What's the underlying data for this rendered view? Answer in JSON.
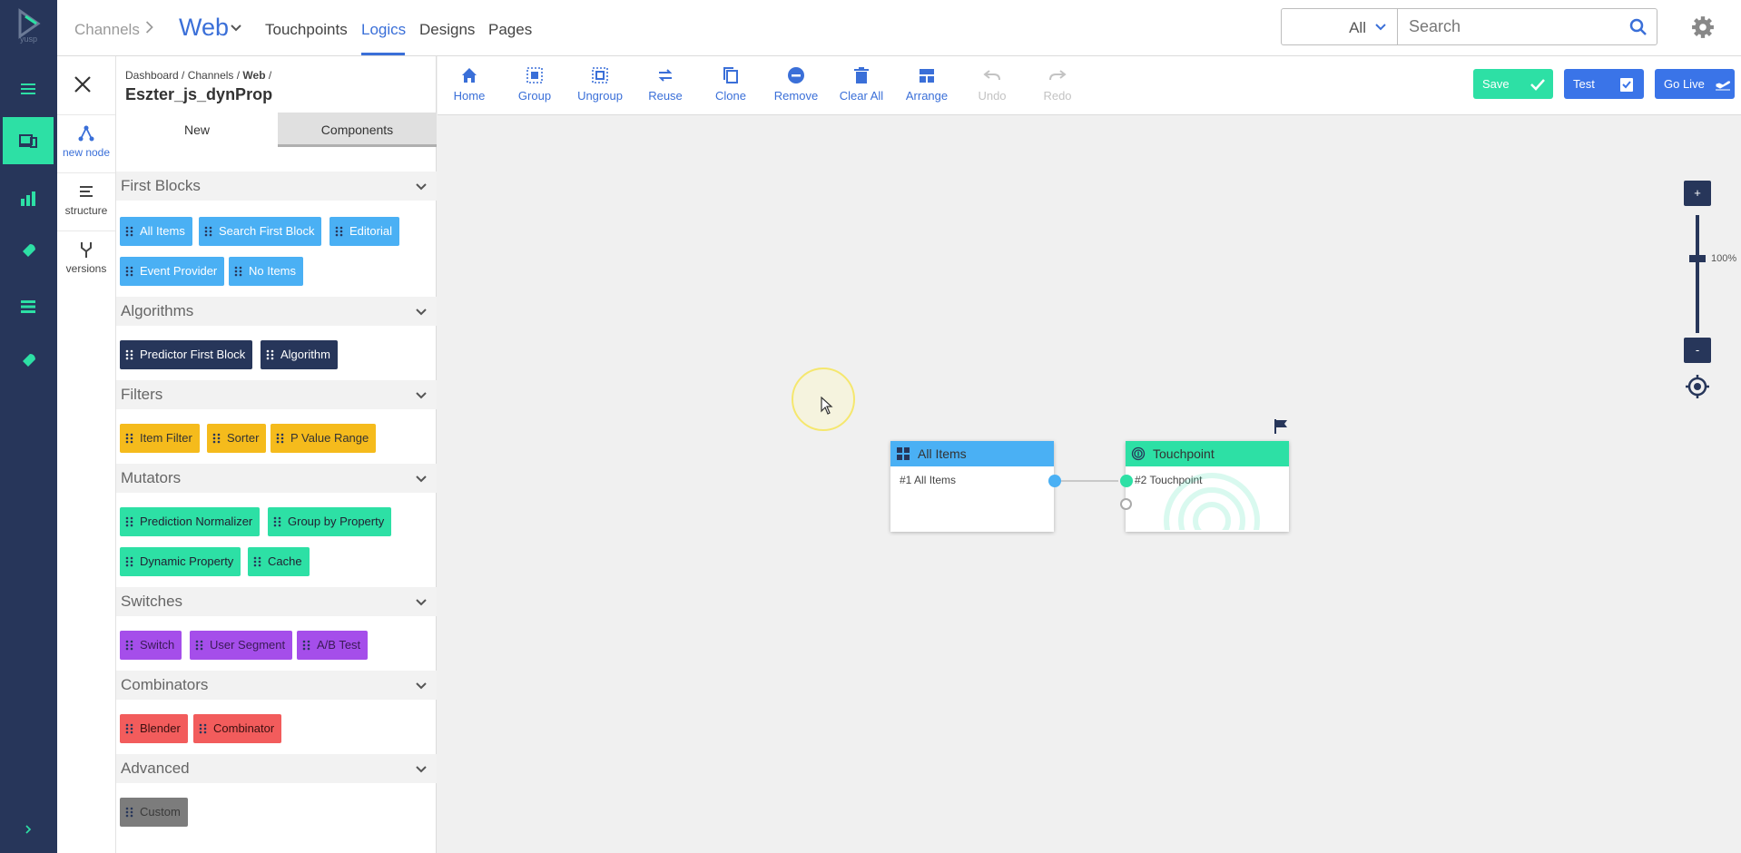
{
  "brand": {
    "logo_text": "yusp"
  },
  "colors": {
    "accent": "#3a6fd8",
    "rail": "#27365a",
    "teal": "#2de0a5",
    "blue": "#4ab0f4",
    "yellow": "#f5bb1c",
    "purple": "#a54eea",
    "red": "#f25c5c",
    "gray": "#7c7c7c"
  },
  "header": {
    "channels_label": "Channels",
    "channel_current": "Web",
    "nav": [
      {
        "label": "Touchpoints"
      },
      {
        "label": "Logics",
        "active": true
      },
      {
        "label": "Designs"
      },
      {
        "label": "Pages"
      }
    ],
    "search": {
      "scope_value": "All",
      "placeholder": "Search"
    }
  },
  "rail_icons": [
    "menu-icon",
    "devices-icon",
    "bar-chart-icon",
    "rocket-icon",
    "list-icon",
    "rocket-alt-icon",
    "expand-chevron-icon"
  ],
  "side_tabs": [
    {
      "label": "new node",
      "icon": "new-node-icon",
      "active": true
    },
    {
      "label": "structure",
      "icon": "structure-icon"
    },
    {
      "label": "versions",
      "icon": "versions-icon"
    }
  ],
  "palette": {
    "breadcrumb": {
      "part1": "Dashboard / Channels / ",
      "part2": "Web",
      "part3": " /"
    },
    "title": "Eszter_js_dynProp",
    "tabs": {
      "new": "New",
      "components": "Components"
    },
    "sections": [
      {
        "title": "First Blocks",
        "items": [
          "All Items",
          "Search First Block",
          "Editorial",
          "Event Provider",
          "No Items"
        ]
      },
      {
        "title": "Algorithms",
        "items": [
          "Predictor First Block",
          "Algorithm"
        ]
      },
      {
        "title": "Filters",
        "items": [
          "Item Filter",
          "Sorter",
          "P Value Range"
        ]
      },
      {
        "title": "Mutators",
        "items": [
          "Prediction Normalizer",
          "Group by Property",
          "Dynamic Property",
          "Cache"
        ]
      },
      {
        "title": "Switches",
        "items": [
          "Switch",
          "User Segment",
          "A/B Test"
        ]
      },
      {
        "title": "Combinators",
        "items": [
          "Blender",
          "Combinator"
        ]
      },
      {
        "title": "Advanced",
        "items": [
          "Custom"
        ]
      }
    ]
  },
  "toolbar": {
    "tools": [
      {
        "label": "Home",
        "icon": "home-icon"
      },
      {
        "label": "Group",
        "icon": "group-icon"
      },
      {
        "label": "Ungroup",
        "icon": "ungroup-icon"
      },
      {
        "label": "Reuse",
        "icon": "reuse-icon"
      },
      {
        "label": "Clone",
        "icon": "clone-icon"
      },
      {
        "label": "Remove",
        "icon": "remove-icon"
      },
      {
        "label": "Clear All",
        "icon": "trash-icon"
      },
      {
        "label": "Arrange",
        "icon": "arrange-icon"
      },
      {
        "label": "Undo",
        "icon": "undo-icon",
        "disabled": true
      },
      {
        "label": "Redo",
        "icon": "redo-icon",
        "disabled": true
      }
    ],
    "save_label": "Save",
    "test_label": "Test",
    "golive_label": "Go Live"
  },
  "canvas": {
    "nodes": [
      {
        "title": "All Items",
        "subtitle": "#1 All Items",
        "icon": "grid-icon"
      },
      {
        "title": "Touchpoint",
        "subtitle": "#2 Touchpoint",
        "icon": "fingerprint-icon"
      }
    ],
    "zoom": {
      "plus": "+",
      "minus": "-",
      "level_label": "100%",
      "level": 1.0
    }
  }
}
